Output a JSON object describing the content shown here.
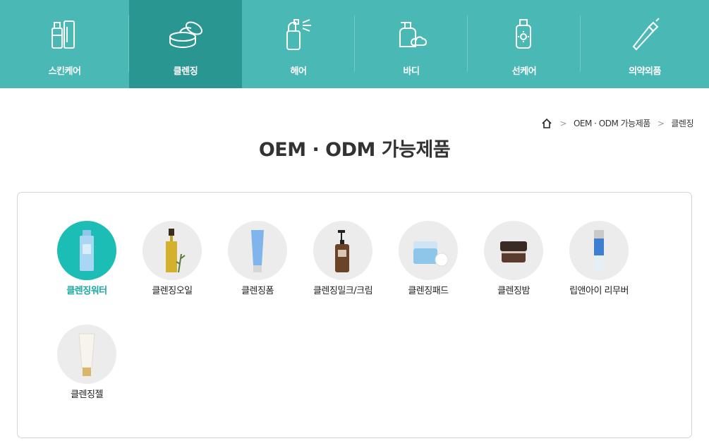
{
  "nav": {
    "items": [
      {
        "label": "스킨케어",
        "icon": "skincare-bottles-icon",
        "active": false
      },
      {
        "label": "클렌징",
        "icon": "cream-jar-icon",
        "active": true
      },
      {
        "label": "헤어",
        "icon": "spray-bottle-icon",
        "active": false
      },
      {
        "label": "바디",
        "icon": "pump-bottle-icon",
        "active": false
      },
      {
        "label": "선케어",
        "icon": "sunscreen-icon",
        "active": false
      },
      {
        "label": "의약외품",
        "icon": "ointment-tube-icon",
        "active": false
      }
    ]
  },
  "breadcrumb": {
    "home_icon": "home-icon",
    "items": [
      "OEM · ODM 가능제품",
      "클렌징"
    ]
  },
  "page_title": "OEM · ODM 가능제품",
  "products": [
    {
      "label": "클렌징워터",
      "active": true
    },
    {
      "label": "클렌징오일",
      "active": false
    },
    {
      "label": "클렌징폼",
      "active": false
    },
    {
      "label": "클렌징밀크/크림",
      "active": false
    },
    {
      "label": "클렌징패드",
      "active": false
    },
    {
      "label": "클렌징밤",
      "active": false
    },
    {
      "label": "립앤아이 리무버",
      "active": false
    },
    {
      "label": "클렌징젤",
      "active": false
    }
  ],
  "colors": {
    "nav_bg": "#4ab8b4",
    "nav_active_bg": "#2a9692",
    "accent": "#1bbdb5",
    "active_text": "#1aa7a2"
  }
}
